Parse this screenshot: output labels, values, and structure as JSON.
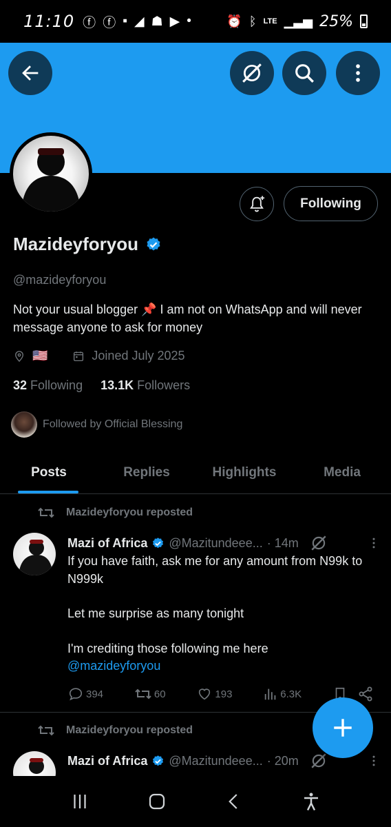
{
  "status_bar": {
    "time": "11:10",
    "battery": "25%",
    "network": "LTE",
    "left_icons": [
      "facebook-icon",
      "facebook-icon",
      "messenger-icon",
      "telegram-icon",
      "mosque-icon",
      "youtube-icon",
      "dot-icon"
    ],
    "right_icons": [
      "alarm-icon",
      "bluetooth-icon",
      "lte-icon",
      "signal-icon",
      "battery-icon"
    ]
  },
  "profile": {
    "display_name": "Mazideyforyou",
    "verified": true,
    "handle": "@mazideyforyou",
    "bio": "Not your usual blogger 📌 I am not on WhatsApp and will never message anyone to ask for money",
    "location_flag": "🇺🇸",
    "joined": "Joined July 2025",
    "following_count": "32",
    "following_label": "Following",
    "followers_count": "13.1K",
    "followers_label": "Followers",
    "followed_by": "Followed by Official Blessing",
    "follow_button": "Following"
  },
  "tabs": [
    {
      "label": "Posts",
      "active": true
    },
    {
      "label": "Replies",
      "active": false
    },
    {
      "label": "Highlights",
      "active": false
    },
    {
      "label": "Media",
      "active": false
    }
  ],
  "posts": [
    {
      "repost_label": "Mazideyforyou reposted",
      "author": "Mazi of Africa",
      "handle": "@Mazitundeee...",
      "time": "· 14m",
      "text_lines": [
        "If you have faith, ask me for any amount from N99k to N999k",
        "Let me surprise as many tonight",
        "I'm crediting those following me here"
      ],
      "mention": "@mazideyforyou",
      "replies": "394",
      "reposts": "60",
      "likes": "193",
      "views": "6.3K"
    },
    {
      "repost_label": "Mazideyforyou reposted",
      "author": "Mazi of Africa",
      "handle": "@Mazitundeee...",
      "time": "· 20m"
    }
  ],
  "colors": {
    "accent": "#1d9bf0",
    "background": "#000000",
    "muted": "#71767b",
    "text": "#e7e9ea",
    "banner_button": "#0f3a57"
  }
}
